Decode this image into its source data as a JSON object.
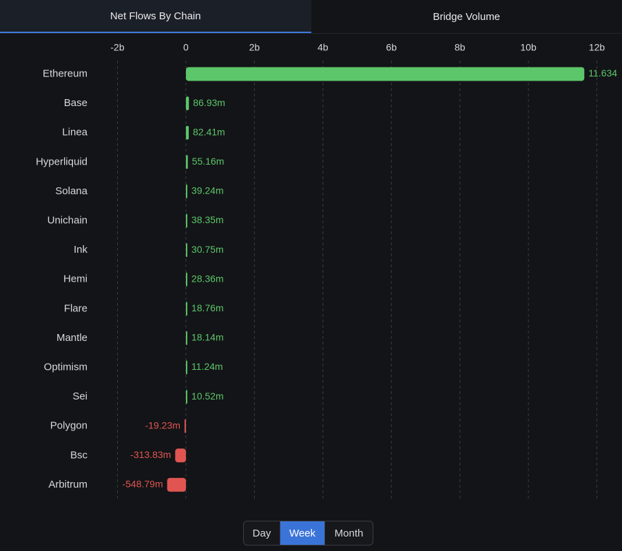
{
  "tabs": [
    {
      "label": "Net Flows By Chain",
      "active": true
    },
    {
      "label": "Bridge Volume",
      "active": false
    }
  ],
  "period": {
    "options": [
      "Day",
      "Week",
      "Month"
    ],
    "selected": "Week"
  },
  "colors": {
    "positive": "#5cc66a",
    "negative": "#e05552",
    "accent": "#3b74d9",
    "grid": "#3a3d44",
    "text": "#d6d8dc"
  },
  "chart_data": {
    "type": "bar",
    "orientation": "horizontal",
    "title": "",
    "xlabel": "",
    "ylabel": "",
    "xlim": [
      -2000000000,
      12000000000
    ],
    "ticks": [
      {
        "value": -2000000000,
        "label": "-2b"
      },
      {
        "value": 0,
        "label": "0"
      },
      {
        "value": 2000000000,
        "label": "2b"
      },
      {
        "value": 4000000000,
        "label": "4b"
      },
      {
        "value": 6000000000,
        "label": "6b"
      },
      {
        "value": 8000000000,
        "label": "8b"
      },
      {
        "value": 10000000000,
        "label": "10b"
      },
      {
        "value": 12000000000,
        "label": "12b"
      }
    ],
    "grid": true,
    "categories": [
      "Ethereum",
      "Base",
      "Linea",
      "Hyperliquid",
      "Solana",
      "Unichain",
      "Ink",
      "Hemi",
      "Flare",
      "Mantle",
      "Optimism",
      "Sei",
      "Polygon",
      "Bsc",
      "Arbitrum"
    ],
    "values": [
      11634000000,
      86930000,
      82410000,
      55160000,
      39240000,
      38350000,
      30750000,
      28360000,
      18760000,
      18140000,
      11240000,
      10520000,
      -19230000,
      -313830000,
      -548790000
    ],
    "value_labels": [
      "11.634",
      "86.93m",
      "82.41m",
      "55.16m",
      "39.24m",
      "38.35m",
      "30.75m",
      "28.36m",
      "18.76m",
      "18.14m",
      "11.24m",
      "10.52m",
      "-19.23m",
      "-313.83m",
      "-548.79m"
    ]
  }
}
